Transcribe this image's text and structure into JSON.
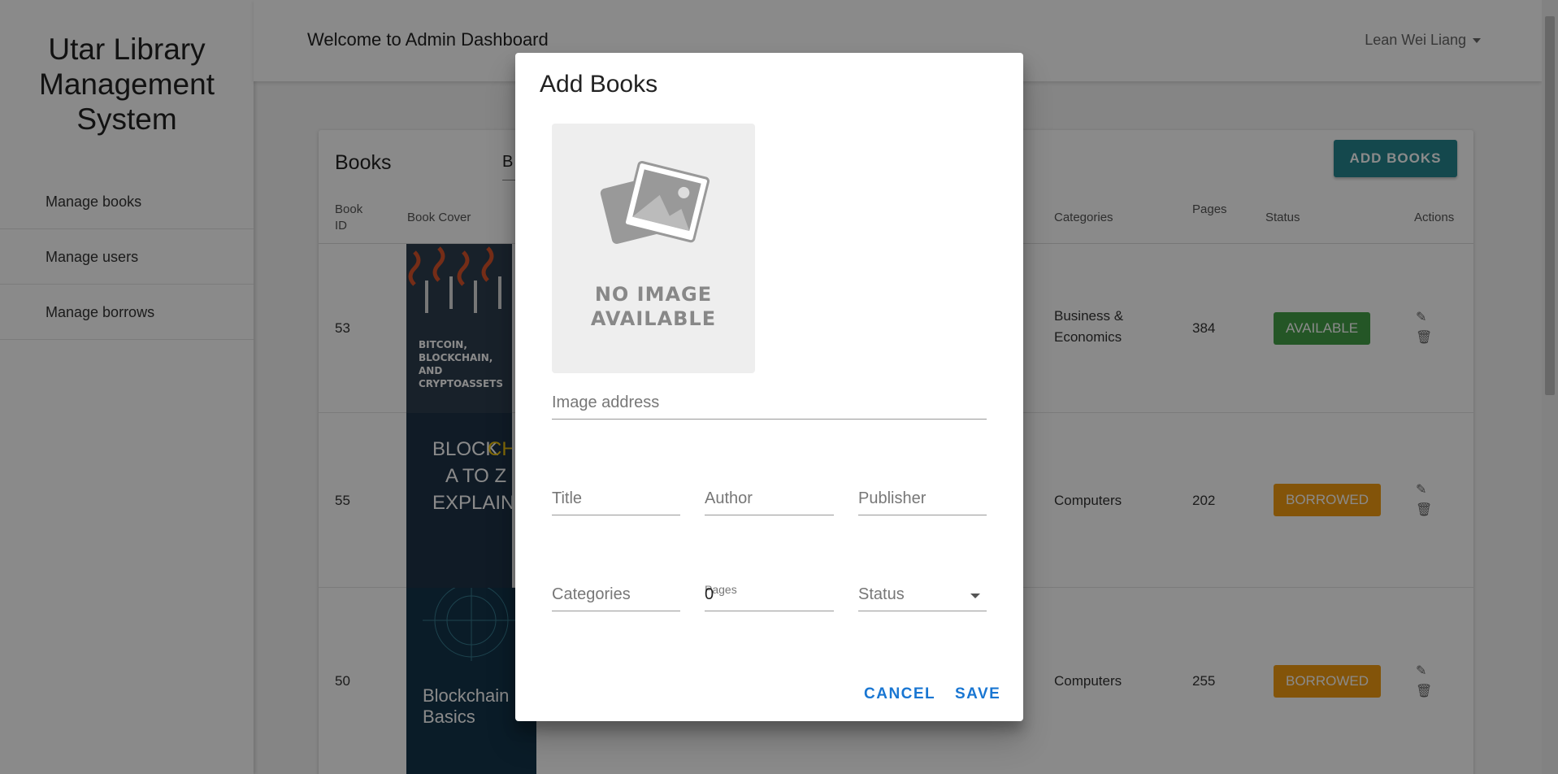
{
  "sidebar": {
    "app_title_lines": [
      "Utar Library",
      "Management",
      "System"
    ],
    "items": [
      {
        "label": "Manage books"
      },
      {
        "label": "Manage users"
      },
      {
        "label": "Manage borrows"
      }
    ]
  },
  "header": {
    "welcome": "Welcome to Admin Dashboard",
    "user_name": "Lean Wei Liang"
  },
  "books_card": {
    "title": "Books",
    "search_partial": "B",
    "add_button": "ADD BOOKS",
    "columns": {
      "book_id": [
        "Book",
        "ID"
      ],
      "book_cover": "Book Cover",
      "categories": "Categories",
      "pages": "Pages",
      "status": "Status",
      "actions": "Actions"
    },
    "rows": [
      {
        "id": "53",
        "categories": [
          "Business &",
          "Economics"
        ],
        "pages": "384",
        "status": "AVAILABLE",
        "status_color": "#43a047",
        "cover_title": "BITCOIN, BLOCKCHAIN, AND CRYPTOASSETS"
      },
      {
        "id": "55",
        "categories": [
          "Computers"
        ],
        "pages": "202",
        "status": "BORROWED",
        "status_color": "#f39c12",
        "cover_title": "BLOCKCHAIN A TO Z EXPLAINED"
      },
      {
        "id": "50",
        "categories": [
          "Computers"
        ],
        "pages": "255",
        "status": "BORROWED",
        "status_color": "#f39c12",
        "cover_title": "Blockchain Basics"
      }
    ]
  },
  "dialog": {
    "title": "Add Books",
    "no_image_lines": [
      "NO IMAGE",
      "AVAILABLE"
    ],
    "image_address_label": "Image address",
    "title_label": "Title",
    "author_label": "Author",
    "publisher_label": "Publisher",
    "categories_label": "Categories",
    "pages_label": "Pages",
    "pages_value": "0",
    "status_label": "Status",
    "cancel_button": "CANCEL",
    "save_button": "SAVE"
  },
  "icons": {
    "edit": "pencil-icon",
    "delete": "trash-icon",
    "no_image": "image-placeholder-icon",
    "user_caret": "caret-down-icon",
    "status_dropdown": "dropdown-arrow-icon"
  },
  "colors": {
    "accent": "#26868e",
    "dialog_buttons": "#1976d2",
    "available": "#43a047",
    "borrowed": "#f39c12"
  }
}
